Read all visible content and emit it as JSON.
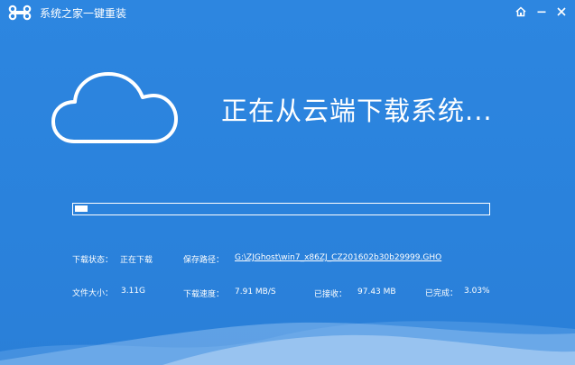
{
  "window": {
    "title": "系统之家一键重装",
    "icons": {
      "logo": "bone-logo-icon",
      "home": "home-icon",
      "minimize": "minimize-icon",
      "close": "close-icon"
    }
  },
  "main": {
    "cloud_icon": "cloud-icon",
    "heading": "正在从云端下载系统..."
  },
  "progress": {
    "fraction": 0.0303
  },
  "info": {
    "status_label": "下载状态：",
    "status_value": "正在下载",
    "path_label": "保存路径：",
    "path_value": "G:\\ZJGhost\\win7_x86ZJ_CZ201602b30b29999.GHO",
    "size_label": "文件大小：",
    "size_value": "3.11G",
    "speed_label": "下载速度：",
    "speed_value": "7.91 MB/S",
    "received_label": "已接收：",
    "received_value": "97.43 MB",
    "completed_label": "已完成：",
    "completed_value": "3.03%"
  },
  "colors": {
    "background": "#2a82dc",
    "foreground": "#ffffff",
    "wave": "#a9cdf2"
  }
}
